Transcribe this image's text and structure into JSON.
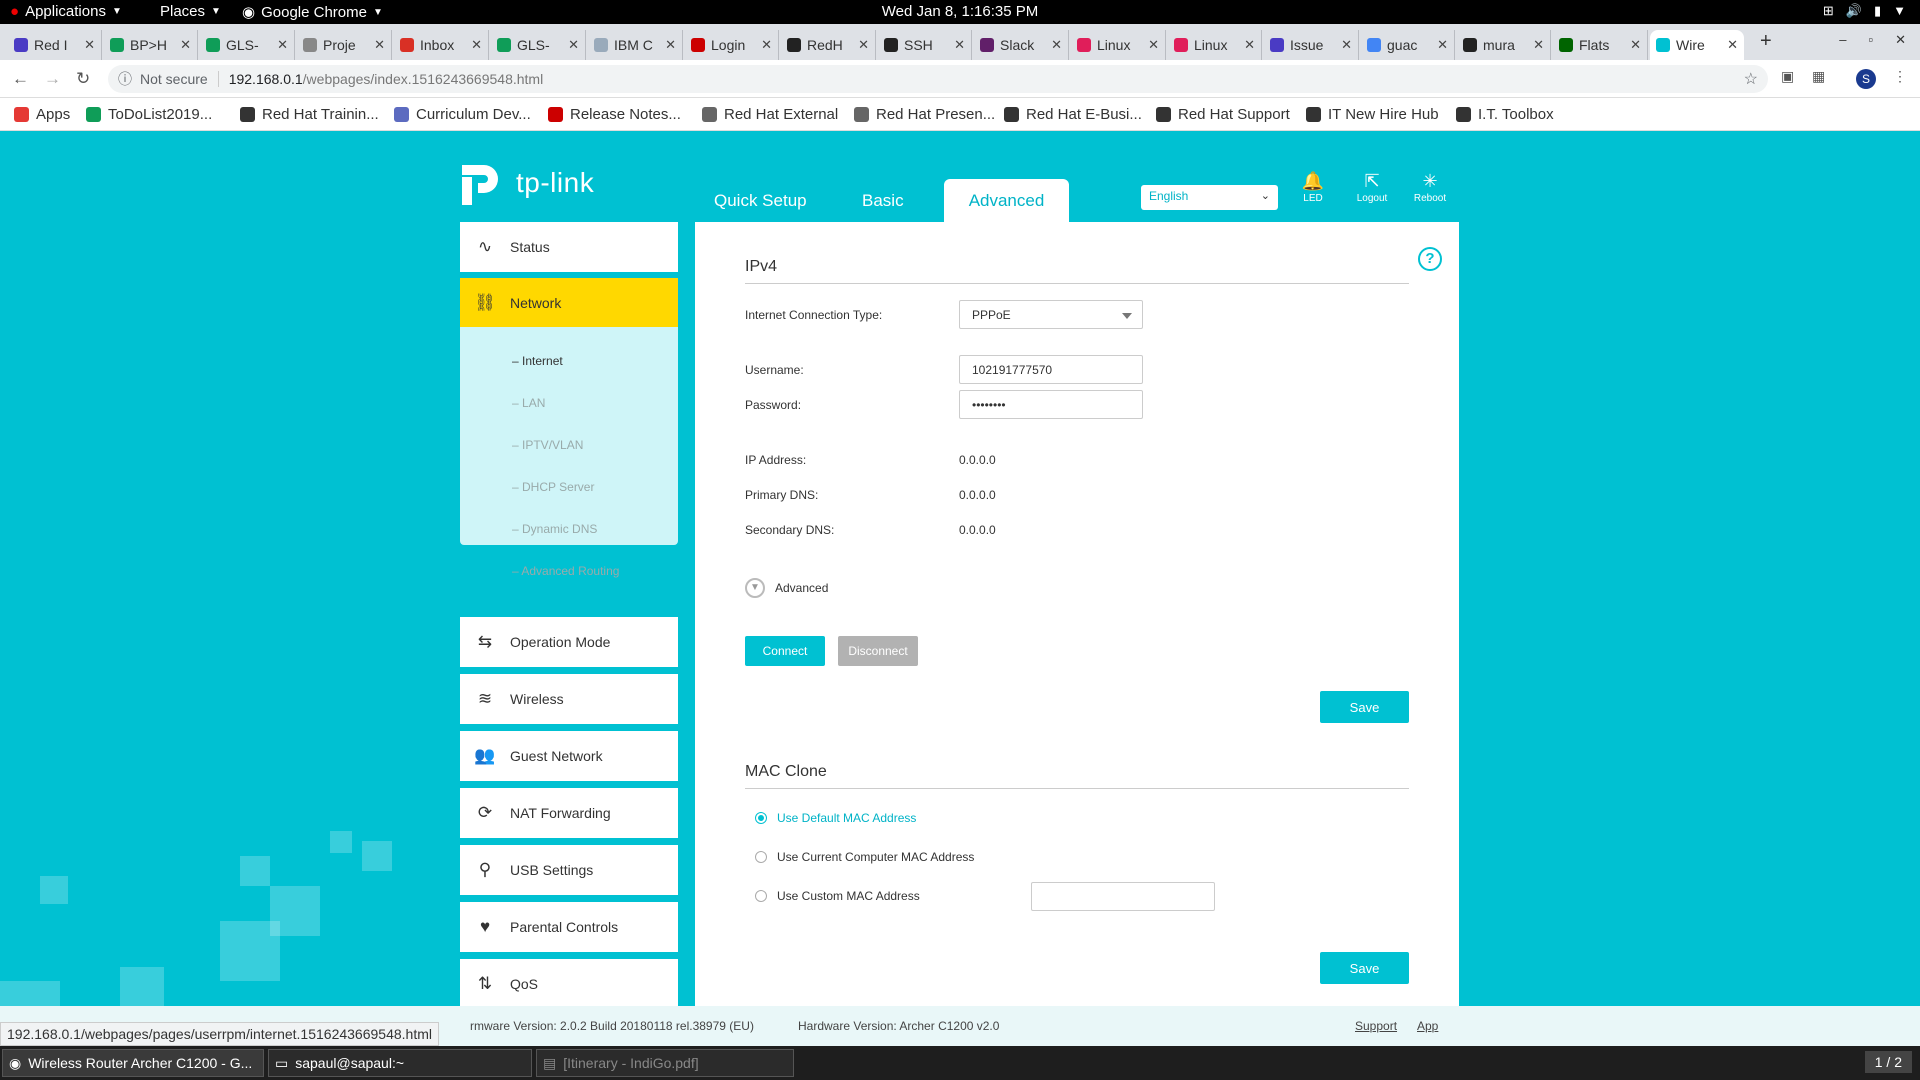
{
  "gnome": {
    "applications": "Applications",
    "places": "Places",
    "chrome": "Google Chrome",
    "clock": "Wed Jan  8,  1:16:35 PM"
  },
  "tabs": [
    {
      "title": "Red I",
      "color": "#4a3bc4"
    },
    {
      "title": "BP>H",
      "color": "#0f9d58"
    },
    {
      "title": "GLS-",
      "color": "#0f9d58"
    },
    {
      "title": "Proje",
      "color": "#888888"
    },
    {
      "title": "Inbox",
      "color": "#d93025"
    },
    {
      "title": "GLS-",
      "color": "#0f9d58"
    },
    {
      "title": "IBM C",
      "color": "#9ab"
    },
    {
      "title": "Login",
      "color": "#cc0000"
    },
    {
      "title": "RedH",
      "color": "#222222"
    },
    {
      "title": "SSH",
      "color": "#222222"
    },
    {
      "title": "Slack",
      "color": "#611f69"
    },
    {
      "title": "Linux",
      "color": "#e01e5a"
    },
    {
      "title": "Linux",
      "color": "#e01e5a"
    },
    {
      "title": "Issue",
      "color": "#4a3bc4"
    },
    {
      "title": "guac",
      "color": "#4285f4"
    },
    {
      "title": "mura",
      "color": "#222222"
    },
    {
      "title": "Flats",
      "color": "#006400"
    },
    {
      "title": "Wire",
      "color": "#00c1d2"
    }
  ],
  "omnibox": {
    "security": "Not secure",
    "host": "192.168.0.1",
    "path": "/webpages/index.1516243669548.html"
  },
  "profile_initial": "S",
  "bookmarks": [
    {
      "label": "Apps",
      "color": "#e53935"
    },
    {
      "label": "ToDoList2019...",
      "color": "#0f9d58"
    },
    {
      "label": "Red Hat Trainin...",
      "color": "#333333"
    },
    {
      "label": "Curriculum Dev...",
      "color": "#5c6bc0"
    },
    {
      "label": "Release Notes...",
      "color": "#cc0000"
    },
    {
      "label": "Red Hat External",
      "color": "#666666"
    },
    {
      "label": "Red Hat Presen...",
      "color": "#666666"
    },
    {
      "label": "Red Hat E-Busi...",
      "color": "#333333"
    },
    {
      "label": "Red Hat Support",
      "color": "#333333"
    },
    {
      "label": "IT New Hire Hub",
      "color": "#333333"
    },
    {
      "label": "I.T. Toolbox",
      "color": "#333333"
    }
  ],
  "router": {
    "brand": "tp-link",
    "nav": {
      "quick_setup": "Quick Setup",
      "basic": "Basic",
      "advanced": "Advanced"
    },
    "language": "English",
    "icons": {
      "led": "LED",
      "logout": "Logout",
      "reboot": "Reboot"
    },
    "sidebar": {
      "status": "Status",
      "network": "Network",
      "sub": [
        "Internet",
        "LAN",
        "IPTV/VLAN",
        "DHCP Server",
        "Dynamic DNS",
        "Advanced Routing"
      ],
      "operation_mode": "Operation Mode",
      "wireless": "Wireless",
      "guest_network": "Guest Network",
      "nat_forwarding": "NAT Forwarding",
      "usb_settings": "USB Settings",
      "parental_controls": "Parental Controls",
      "qos": "QoS"
    },
    "ipv4": {
      "title": "IPv4",
      "conn_type_label": "Internet Connection Type:",
      "conn_type": "PPPoE",
      "username_label": "Username:",
      "username": "102191777570",
      "password_label": "Password:",
      "password": "••••••••",
      "ip_label": "IP Address:",
      "ip": "0.0.0.0",
      "pdns_label": "Primary DNS:",
      "pdns": "0.0.0.0",
      "sdns_label": "Secondary DNS:",
      "sdns": "0.0.0.0",
      "advanced": "Advanced",
      "connect": "Connect",
      "disconnect": "Disconnect",
      "save": "Save"
    },
    "mac": {
      "title": "MAC Clone",
      "opt_default": "Use Default MAC Address",
      "opt_current": "Use Current Computer MAC Address",
      "opt_custom": "Use Custom MAC Address",
      "save": "Save"
    },
    "footer": {
      "firmware": "rmware Version: 2.0.2 Build 20180118 rel.38979 (EU)",
      "hardware": "Hardware Version: Archer C1200 v2.0",
      "support": "Support",
      "app": "App"
    }
  },
  "status_url": "192.168.0.1/webpages/pages/userrpm/internet.1516243669548.html",
  "taskbar": {
    "chrome": "Wireless Router Archer C1200 - G...",
    "terminal": "sapaul@sapaul:~",
    "pdf": "[Itinerary - IndiGo.pdf]",
    "workspace": "1 / 2"
  }
}
